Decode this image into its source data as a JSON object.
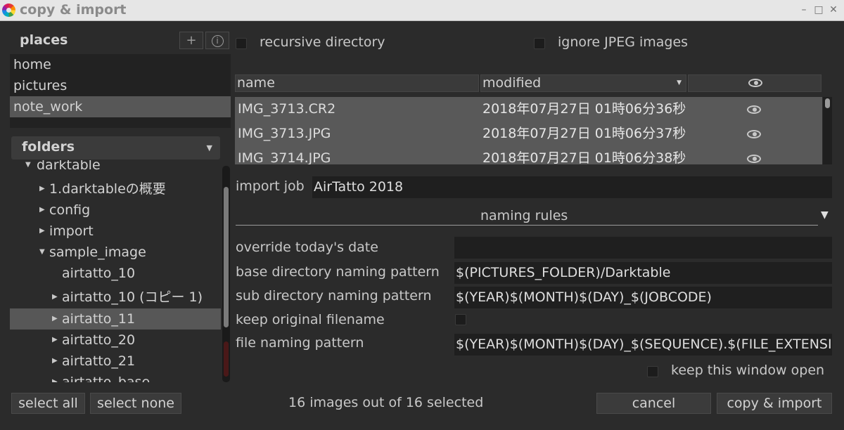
{
  "window": {
    "title": "copy & import"
  },
  "places": {
    "title": "places",
    "add_button": "+",
    "info_button": "i",
    "items": [
      {
        "label": "home",
        "selected": false
      },
      {
        "label": "pictures",
        "selected": false
      },
      {
        "label": "note_work",
        "selected": true
      }
    ]
  },
  "folders": {
    "combo_label": "folders",
    "tree": [
      {
        "label": "darktable",
        "expander": "down"
      },
      {
        "label": "1.darktableの概要",
        "expander": "right"
      },
      {
        "label": "config",
        "expander": "right"
      },
      {
        "label": "import",
        "expander": "right"
      },
      {
        "label": "sample_image",
        "expander": "down"
      },
      {
        "label": "airtatto_10",
        "expander": "none"
      },
      {
        "label": "airtatto_10 (コピー 1)",
        "expander": "right"
      },
      {
        "label": "airtatto_11",
        "expander": "right",
        "selected": true
      },
      {
        "label": "airtatto_20",
        "expander": "right"
      },
      {
        "label": "airtatto_21",
        "expander": "right"
      },
      {
        "label": "airtatto_base",
        "expander": "right"
      }
    ]
  },
  "options": {
    "recursive_directory": "recursive directory",
    "ignore_jpeg": "ignore JPEG images"
  },
  "file_table": {
    "headers": {
      "name": "name",
      "modified": "modified"
    },
    "rows": [
      {
        "name": "IMG_3713.CR2",
        "modified": "2018年07月27日 01時06分36秒"
      },
      {
        "name": "IMG_3713.JPG",
        "modified": "2018年07月27日 01時06分37秒"
      },
      {
        "name": "IMG_3714.JPG",
        "modified": "2018年07月27日 01時06分38秒"
      }
    ]
  },
  "import_job": {
    "label": "import job",
    "value": "AirTatto 2018"
  },
  "naming_rules": {
    "title": "naming rules",
    "override_date_label": "override today's date",
    "override_date_value": "",
    "base_dir_label": "base directory naming pattern",
    "base_dir_value": "$(PICTURES_FOLDER)/Darktable",
    "sub_dir_label": "sub directory naming pattern",
    "sub_dir_value": "$(YEAR)$(MONTH)$(DAY)_$(JOBCODE)",
    "keep_filename_label": "keep original filename",
    "file_pattern_label": "file naming pattern",
    "file_pattern_value": "$(YEAR)$(MONTH)$(DAY)_$(SEQUENCE).$(FILE_EXTENSION)"
  },
  "keep_window_open": "keep this window open",
  "footer": {
    "select_all": "select all",
    "select_none": "select none",
    "status": "16 images out of 16 selected",
    "cancel": "cancel",
    "copy_import": "copy & import"
  },
  "colors": {
    "background": "#2b2b2b",
    "selection": "#575757",
    "file_list_bg": "#595959",
    "input_bg": "#1f1f1f"
  }
}
